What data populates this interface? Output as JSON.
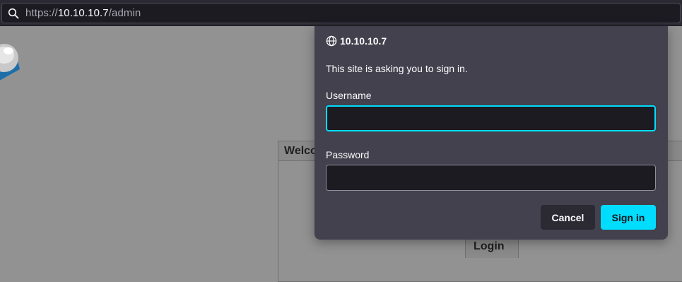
{
  "browser": {
    "url_scheme": "https://",
    "url_host": "10.10.10.7",
    "url_path": "/admin"
  },
  "page": {
    "welcome_header": "Welco",
    "login_tab": "Login"
  },
  "auth_dialog": {
    "site": "10.10.10.7",
    "message": "This site is asking you to sign in.",
    "username_label": "Username",
    "username_value": "",
    "password_label": "Password",
    "password_value": "",
    "cancel_label": "Cancel",
    "signin_label": "Sign in"
  },
  "colors": {
    "accent": "#00ddff",
    "dialog_bg": "#42414d",
    "page_dim": "#929292",
    "field_bg": "#1c1b22"
  },
  "icons": {
    "urlbar": "search-icon",
    "dialog_title": "globe-icon",
    "page_logo": "logo-icon"
  }
}
